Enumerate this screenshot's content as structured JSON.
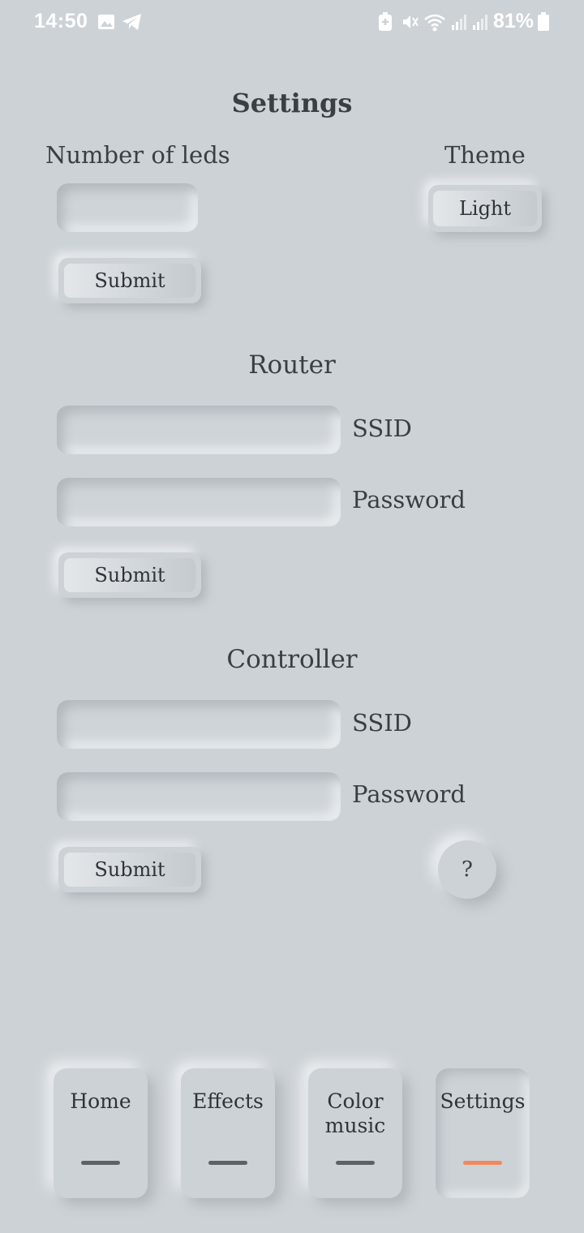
{
  "status_bar": {
    "time": "14:50",
    "battery_percent": "81%"
  },
  "page": {
    "title": "Settings"
  },
  "leds": {
    "label": "Number of leds",
    "value": "",
    "submit": "Submit"
  },
  "theme": {
    "label": "Theme",
    "value": "Light"
  },
  "router": {
    "heading": "Router",
    "ssid_label": "SSID",
    "ssid_value": "",
    "password_label": "Password",
    "password_value": "",
    "submit": "Submit"
  },
  "controller": {
    "heading": "Controller",
    "ssid_label": "SSID",
    "ssid_value": "",
    "password_label": "Password",
    "password_value": "",
    "submit": "Submit"
  },
  "help": {
    "label": "?"
  },
  "nav": {
    "items": [
      {
        "label": "Home",
        "active": false
      },
      {
        "label": "Effects",
        "active": false
      },
      {
        "label": "Color music",
        "active": false
      },
      {
        "label": "Settings",
        "active": true
      }
    ],
    "accent": "#f08a5d",
    "indicator": "#5c6368"
  },
  "colors": {
    "background": "#cdd2d6",
    "text": "#3a3f44"
  }
}
